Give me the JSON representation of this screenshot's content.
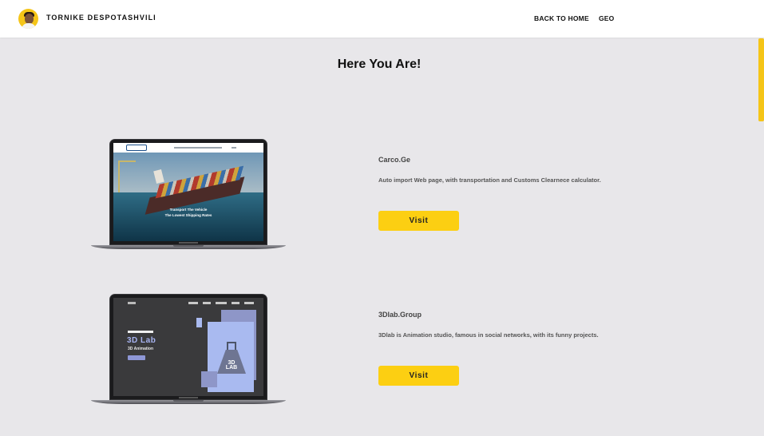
{
  "header": {
    "brand": "TORNIKE DESPOTASHVILI",
    "nav": [
      {
        "label": "BACK TO HOME"
      },
      {
        "label": "GEO"
      }
    ]
  },
  "main": {
    "title": "Here You Are!",
    "projects": [
      {
        "name": "Carco.Ge",
        "description": "Auto import Web page, with transportation and Customs Clearnece calculator.",
        "button_label": "Visit",
        "screen": {
          "logo": "CARCO",
          "tagline_1": "Transport The Vehicle",
          "tagline_2": "The Lowest Shipping Rates"
        }
      },
      {
        "name": "3Dlab.Group",
        "description": "3Dlab is Animation studio, famous in social networks, with its funny projects.",
        "button_label": "Visit",
        "screen": {
          "headline": "3D Lab",
          "subhead": "3D Animation",
          "flask_text": "3D LAB"
        }
      }
    ]
  },
  "colors": {
    "accent": "#fccf12",
    "page_background": "#e8e7ea",
    "header_background": "#ffffff"
  }
}
